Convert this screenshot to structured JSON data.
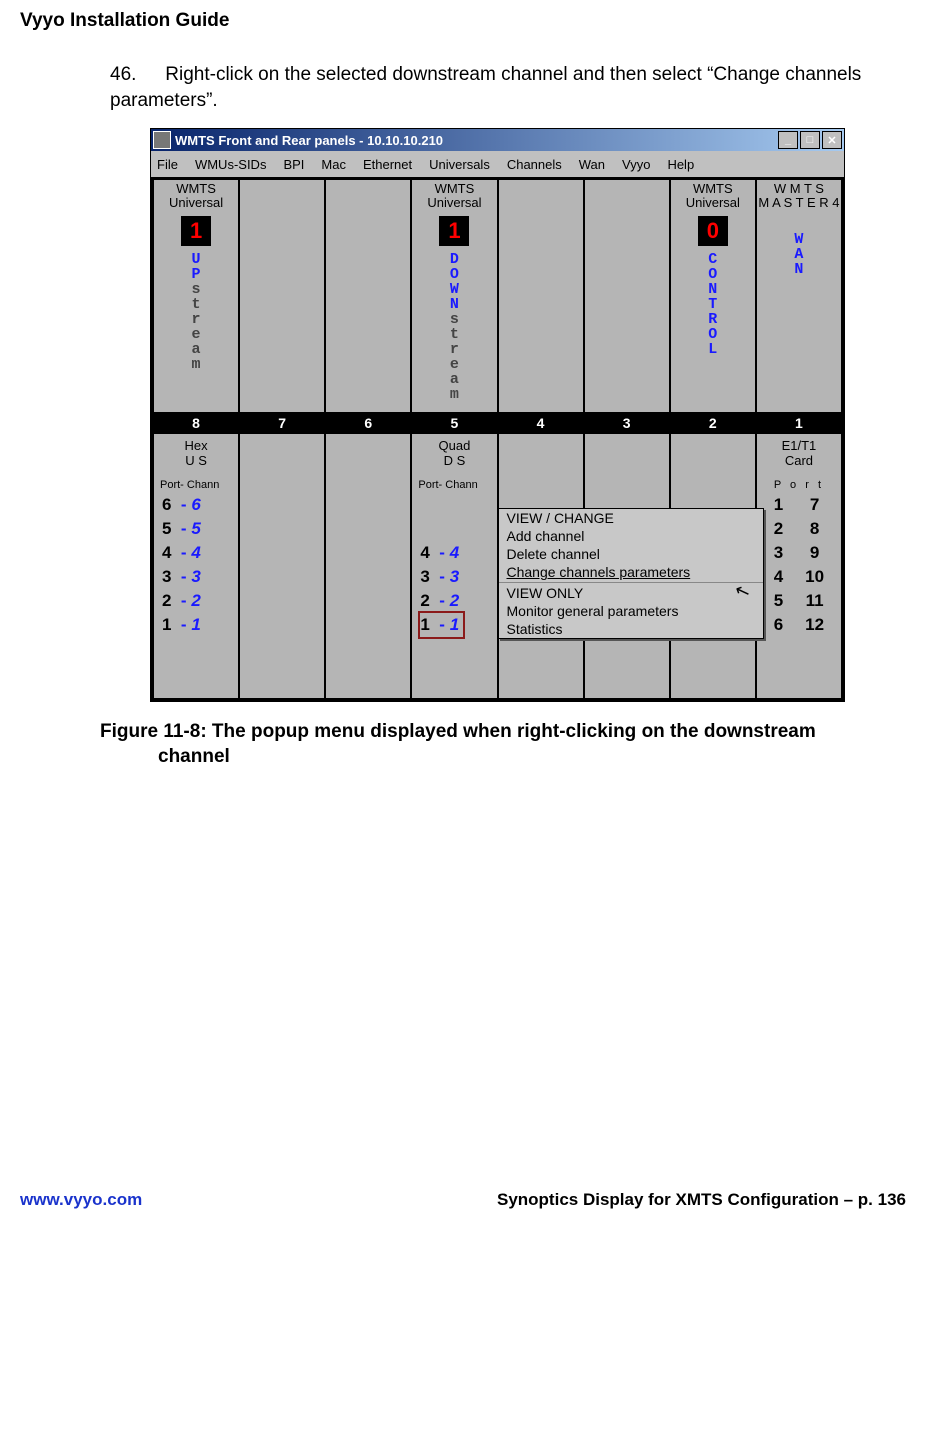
{
  "doc": {
    "header": "Vyyo Installation Guide",
    "instruction_number": "46.",
    "instruction_text": "Right-click on the selected downstream channel and then select “Change channels parameters”.",
    "caption_line1": "Figure 11-8: The popup menu displayed when right-clicking on the downstream",
    "caption_line2": "channel",
    "footer_left_url": "www.vyyo.com",
    "footer_right": "Synoptics Display for XMTS Configuration – p. 136"
  },
  "window": {
    "title": "WMTS Front and Rear panels - 10.10.10.210",
    "minimize": "_",
    "maximize": "□",
    "close": "✕",
    "menus": [
      "File",
      "WMUs-SIDs",
      "BPI",
      "Mac",
      "Ethernet",
      "Universals",
      "Channels",
      "Wan",
      "Vyyo",
      "Help"
    ]
  },
  "front_slots": {
    "s8": {
      "top1": "WMTS",
      "top2": "Universal",
      "count": "1",
      "vhi": "UP",
      "vlo": "stream"
    },
    "s5": {
      "top1": "WMTS",
      "top2": "Universal",
      "count": "1",
      "vhi": "DOWN",
      "vlo": "stream"
    },
    "s2": {
      "top1": "WMTS",
      "top2": "Universal",
      "count": "0",
      "vhi": "CONTROL",
      "vlo": ""
    },
    "s1": {
      "top1": "W M T S",
      "top2": "M A S T E R 4",
      "vhi": "WAN",
      "vlo": ""
    }
  },
  "slot_numbers": [
    "8",
    "7",
    "6",
    "5",
    "4",
    "3",
    "2",
    "1"
  ],
  "rear_slots": {
    "r8": {
      "head1": "Hex",
      "head2": "U S",
      "sub": "Port- Chann",
      "rows": [
        "6  - 6",
        "5  - 5",
        "4  - 4",
        "3  - 3",
        "2  - 2",
        "1  - 1"
      ]
    },
    "r5": {
      "head1": "Quad",
      "head2": "D S",
      "sub": "Port- Chann",
      "rows": [
        "",
        "",
        "4  - 4",
        "3  - 3",
        "2  - 2",
        "1  - 1"
      ],
      "selected_index": 5
    },
    "r1": {
      "head1": "E1/T1",
      "head2": "Card",
      "port_label": "P o r t",
      "left": [
        "1",
        "2",
        "3",
        "4",
        "5",
        "6"
      ],
      "right": [
        "7",
        "8",
        "9",
        "10",
        "11",
        "12"
      ]
    }
  },
  "context_menu": {
    "head1": "VIEW / CHANGE",
    "items1": [
      "Add channel",
      "Delete channel",
      "Change channels parameters"
    ],
    "head2": "VIEW ONLY",
    "items2": [
      "Monitor general parameters",
      "Statistics"
    ]
  }
}
